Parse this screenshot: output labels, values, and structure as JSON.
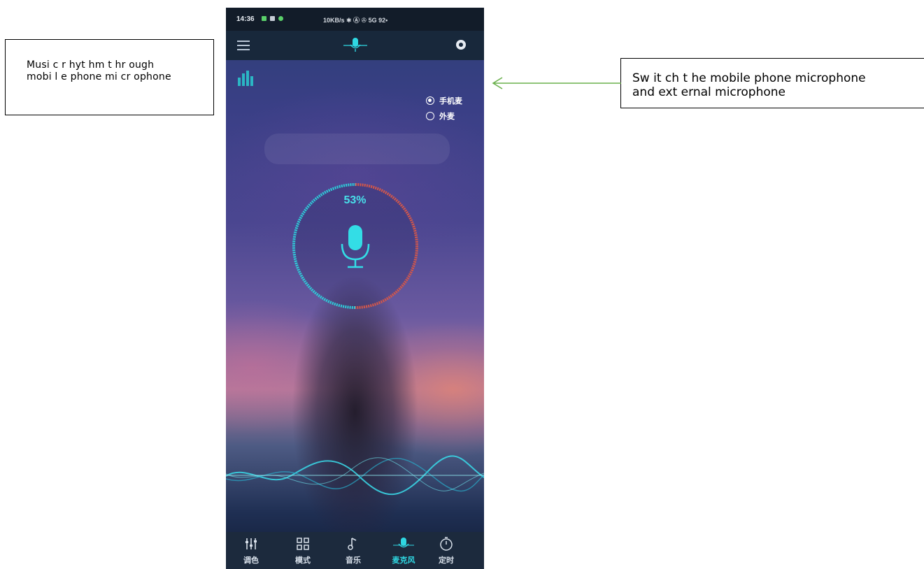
{
  "annotations": {
    "left": {
      "line1": "Musi c  r hyt hm t hr ough",
      "line2": "mobi l e  phone  mi cr ophone"
    },
    "right": {
      "line1": "Sw it ch  t he mobile phone microphone",
      "line2": "and ext ernal microphone"
    }
  },
  "phone": {
    "status": {
      "time": "14:36",
      "network": "10KB/s ✱ Ⓐ ✇ 5G 92•"
    },
    "source_options": [
      {
        "label": "手机麦",
        "selected": true
      },
      {
        "label": "外麦",
        "selected": false
      }
    ],
    "level_percent": "53%",
    "level_value": 0.53,
    "nav": [
      {
        "label": "调色",
        "icon": "sliders-icon",
        "active": false
      },
      {
        "label": "模式",
        "icon": "grid-icon",
        "active": false
      },
      {
        "label": "音乐",
        "icon": "music-note-icon",
        "active": false
      },
      {
        "label": "麦克风",
        "icon": "microphone-wave-icon",
        "active": true
      },
      {
        "label": "定时",
        "icon": "timer-icon",
        "active": false
      }
    ],
    "colors": {
      "accent": "#2fd7e2",
      "ring_red": "#d2574b",
      "bar_dark": "#1c2a3d"
    }
  }
}
